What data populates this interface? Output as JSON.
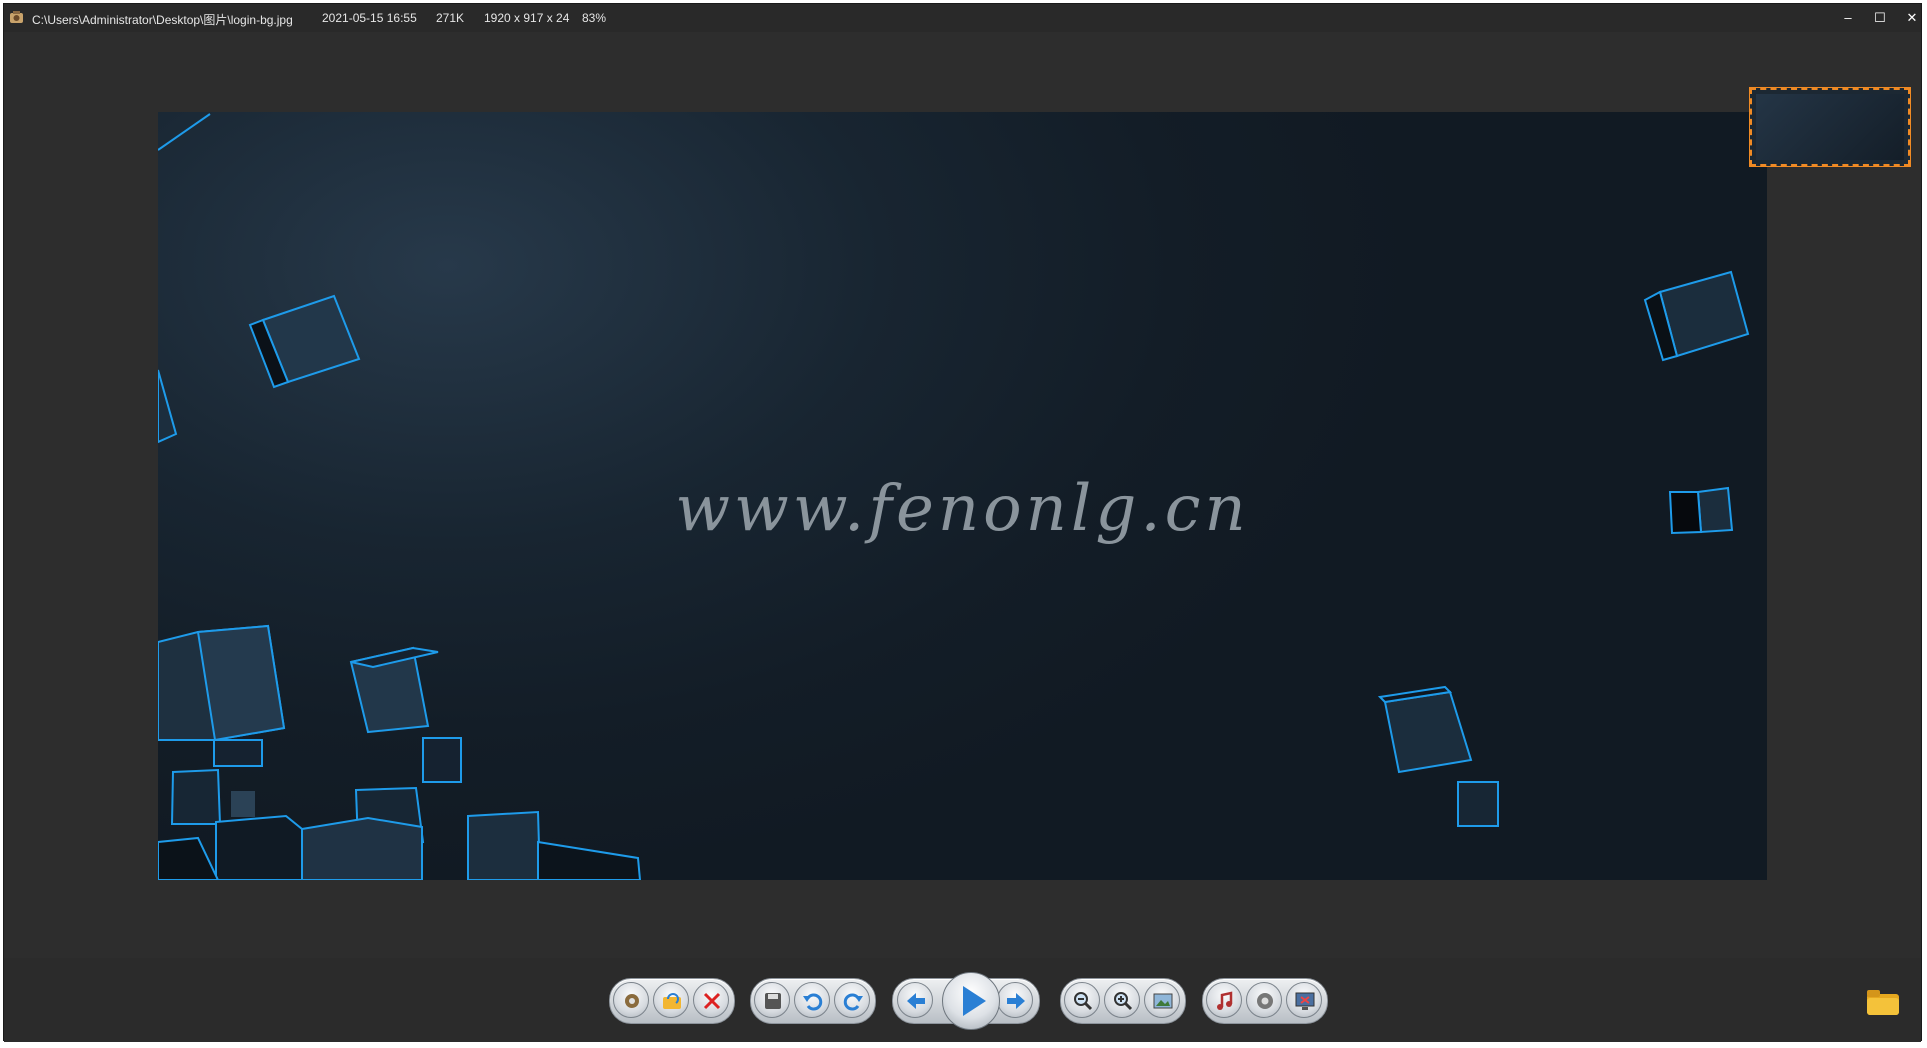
{
  "titlebar": {
    "path": "C:\\Users\\Administrator\\Desktop\\图片\\login-bg.jpg",
    "date": "2021-05-15 16:55",
    "filesize": "271K",
    "dimensions": "1920 x 917 x 24",
    "zoom": "83%",
    "minimize": "–",
    "maximize": "☐",
    "close": "✕"
  },
  "image": {
    "watermark": "www.fenonlg.cn"
  },
  "toolbar": {
    "groups": [
      [
        "settings-icon",
        "open-folder-icon",
        "delete-icon"
      ],
      [
        "save-icon",
        "rotate-left-icon",
        "rotate-right-icon"
      ],
      [
        "previous-icon",
        "play-icon",
        "next-icon"
      ],
      [
        "zoom-out-icon",
        "zoom-in-icon",
        "fit-image-icon"
      ],
      [
        "music-icon",
        "gear-icon",
        "fullscreen-icon"
      ]
    ],
    "folder": "folder-icon"
  },
  "colors": {
    "accent": "#f08a24",
    "background": "#2d2d2d",
    "cube_edge": "#1e9bea"
  }
}
